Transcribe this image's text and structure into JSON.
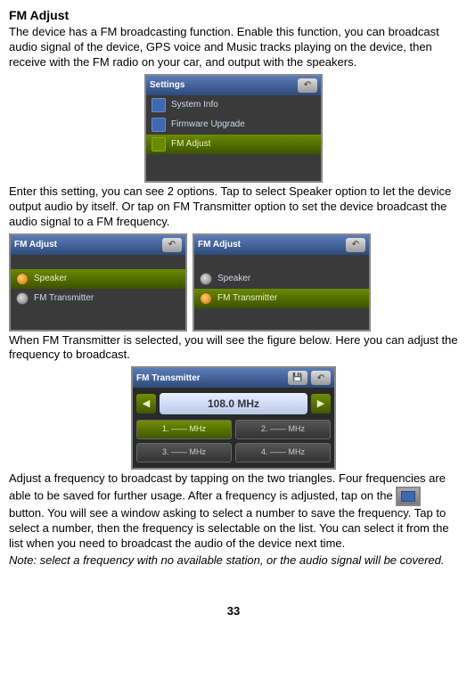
{
  "title": "FM Adjust",
  "para1": "The device has a FM broadcasting function. Enable this function, you can broadcast audio signal of the device, GPS voice and Music tracks playing on the device, then receive with the FM radio on your car, and output with the speakers.",
  "para2": "Enter this setting, you can see 2 options. Tap to select Speaker option to let the device output audio by itself. Or tap on FM Transmitter option to set the device broadcast the audio signal to a FM frequency.",
  "para3": "When FM Transmitter is selected, you will see the figure below. Here you can adjust the frequency to broadcast.",
  "para4a": "Adjust a frequency to broadcast by tapping on the two triangles. Four frequencies are able to be saved for further usage. After a frequency is adjusted, tap on the",
  "para4b": " button. You will see a window asking to select a number to save the frequency. Tap to select a number, then the frequency is selectable on the list. You can select it from the list when you need to broadcast the audio of the device next time.",
  "note": "Note: select a frequency with no available station, or the audio signal will be covered.",
  "page": "33",
  "shot1": {
    "header": "Settings",
    "r1": "System Info",
    "r2": "Firmware Upgrade",
    "r3": "FM Adjust"
  },
  "shot2": {
    "header": "FM Adjust",
    "opt1": "Speaker",
    "opt2": "FM Transmitter"
  },
  "shot3": {
    "header": "FM Adjust",
    "opt1": "Speaker",
    "opt2": "FM Transmitter"
  },
  "shot4": {
    "header": "FM Transmitter",
    "freq": "108.0 MHz",
    "p1": "1. —— MHz",
    "p2": "2. —— MHz",
    "p3": "3. —— MHz",
    "p4": "4. —— MHz"
  }
}
